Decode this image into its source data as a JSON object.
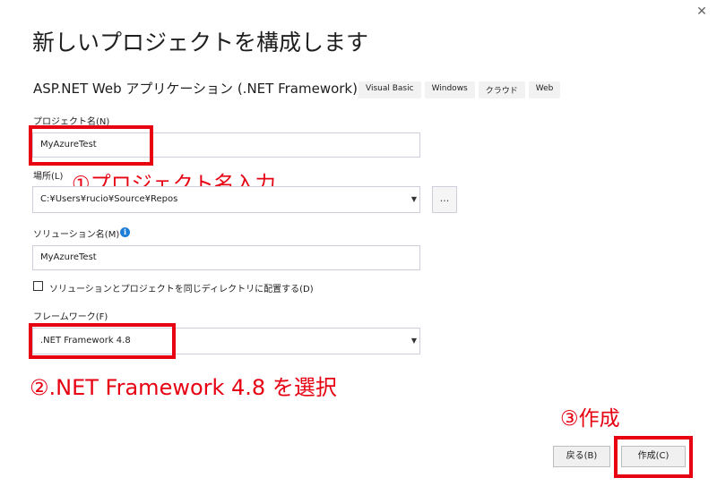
{
  "window": {
    "close_glyph": "✕"
  },
  "header": {
    "title": "新しいプロジェクトを構成します",
    "template_name": "ASP.NET Web アプリケーション (.NET Framework)",
    "tags": [
      "Visual Basic",
      "Windows",
      "クラウド",
      "Web"
    ]
  },
  "form": {
    "project_name_label": "プロジェクト名(N)",
    "project_name_value": "MyAzureTest",
    "location_label": "場所(L)",
    "location_value": "C:¥Users¥rucio¥Source¥Repos",
    "browse_label": "...",
    "solution_name_label": "ソリューション名(M)",
    "solution_name_value": "MyAzureTest",
    "same_dir_checkbox_label": "ソリューションとプロジェクトを同じディレクトリに配置する(D)",
    "same_dir_checked": false,
    "framework_label": "フレームワーク(F)",
    "framework_value": ".NET Framework 4.8"
  },
  "buttons": {
    "back_label": "戻る(B)",
    "create_label": "作成(C)"
  },
  "annotations": {
    "step1": "①プロジェクト名入力",
    "step2": "②.NET Framework 4.8 を選択",
    "step3": "③作成"
  },
  "colors": {
    "annotation_red": "#e60012",
    "info_blue": "#1c7ed6"
  },
  "icons": {
    "close": "close-icon",
    "info": "info-icon",
    "dropdown": "chevron-down-icon"
  }
}
